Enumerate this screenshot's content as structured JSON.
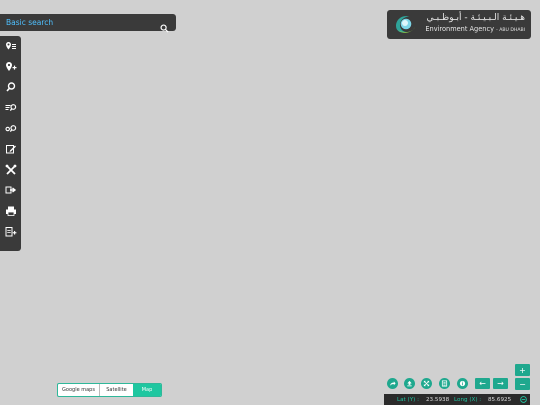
{
  "search": {
    "placeholder": "Basic search"
  },
  "toolbar": {
    "items": [
      {
        "icon": "marker-list-icon"
      },
      {
        "icon": "add-marker-icon"
      },
      {
        "icon": "search-icon"
      },
      {
        "icon": "list-search-icon"
      },
      {
        "icon": "location-search-icon"
      },
      {
        "icon": "edit-icon"
      },
      {
        "icon": "tools-icon"
      },
      {
        "icon": "export-icon"
      },
      {
        "icon": "print-icon"
      },
      {
        "icon": "add-document-icon"
      }
    ]
  },
  "logo": {
    "arabic": "هـيـئـة الـبـيـئـة - أبـوظـبـي",
    "english": "Environment Agency",
    "english_small": "- ABU DHABI"
  },
  "map_types": {
    "options": [
      "Google maps",
      "Satellite",
      "Map"
    ],
    "selected": "Map"
  },
  "controls": {
    "zoom_in": "+",
    "zoom_out": "−",
    "prev": "←",
    "next": "→"
  },
  "coords": {
    "lat_label": "Lat (Y) :",
    "lat_value": "23.5938",
    "long_label": "Long (X) :",
    "long_value": "85.6925"
  },
  "colors": {
    "accent": "#1fa88e",
    "panel": "#3a3a3a",
    "map_bg": "#d0d0d0",
    "search_text": "#4ec0ff"
  }
}
